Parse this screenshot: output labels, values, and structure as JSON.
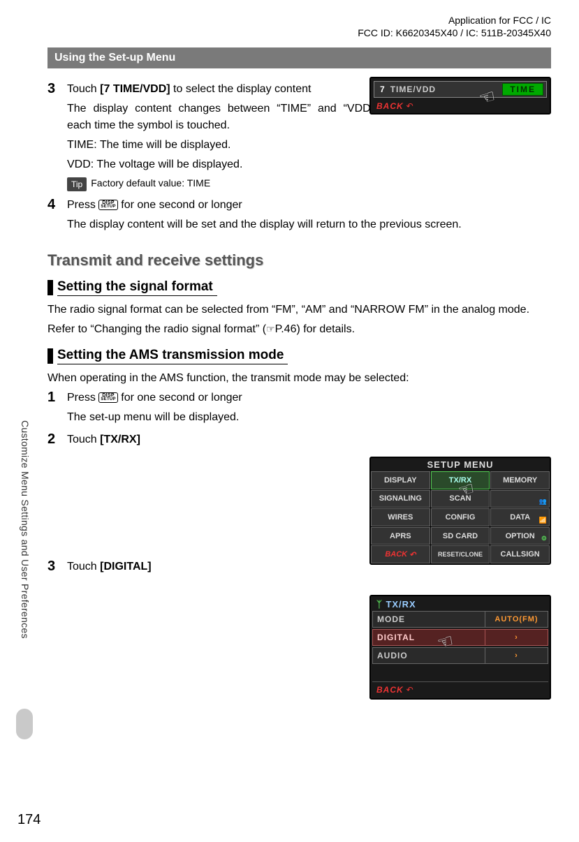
{
  "header": {
    "line1": "Application for FCC / IC",
    "line2": "FCC ID: K6620345X40 / IC: 511B-20345X40"
  },
  "banner": "Using the Set-up Menu",
  "step3": {
    "num": "3",
    "line1_a": "Touch ",
    "line1_b": "[7 TIME/VDD]",
    "line1_c": " to select the display content",
    "line2": "The display content changes between “TIME” and “VDD” each time the symbol is touched.",
    "line3": "TIME: The time will be displayed.",
    "line4": "VDD: The voltage will be displayed.",
    "tip_label": "Tip",
    "tip_text": "Factory default value: TIME"
  },
  "step4": {
    "num": "4",
    "line1_a": "Press ",
    "line1_b": " for one second or longer",
    "line2": "The display content will be set and the display will return to the previous screen."
  },
  "disp_icon": {
    "l1": "DISP",
    "l2": "SETUP"
  },
  "h2": "Transmit and receive settings",
  "h3a": "Setting the signal format",
  "sigfmt": {
    "p1": "The radio signal format can be selected from “FM”, “AM” and “NARROW FM” in the analog mode.",
    "p2_a": "Refer to “Changing the radio signal format” (",
    "p2_b": "P.46) for details."
  },
  "h3b": "Setting the AMS transmission mode",
  "ams_intro": "When operating in the AMS function, the transmit mode may be selected:",
  "ams1": {
    "num": "1",
    "line1_a": "Press ",
    "line1_b": " for one second or longer",
    "line2": "The set-up menu will be displayed."
  },
  "ams2": {
    "num": "2",
    "line1_a": "Touch ",
    "line1_b": "[TX/RX]"
  },
  "ams3": {
    "num": "3",
    "line1_a": "Touch ",
    "line1_b": "[DIGITAL]"
  },
  "ss1": {
    "num": "7",
    "label": "TIME/VDD",
    "value": "TIME",
    "back": "BACK"
  },
  "ss2": {
    "title": "SETUP MENU",
    "cells": [
      "DISPLAY",
      "TX/RX",
      "MEMORY",
      "SIGNALING",
      "SCAN",
      "",
      "WIRES",
      "CONFIG",
      "DATA",
      "APRS",
      "SD CARD",
      "OPTION",
      "BACK",
      "RESET/CLONE",
      "CALLSIGN"
    ]
  },
  "ss3": {
    "title": "TX/RX",
    "rows": [
      {
        "label": "MODE",
        "value": "AUTO(FM)"
      },
      {
        "label": "DIGITAL",
        "value": "›"
      },
      {
        "label": "AUDIO",
        "value": "›"
      }
    ],
    "back": "BACK"
  },
  "side_tab": "Customize Menu Settings and User Preferences",
  "page_num": "174",
  "hand_glyph": "☜"
}
